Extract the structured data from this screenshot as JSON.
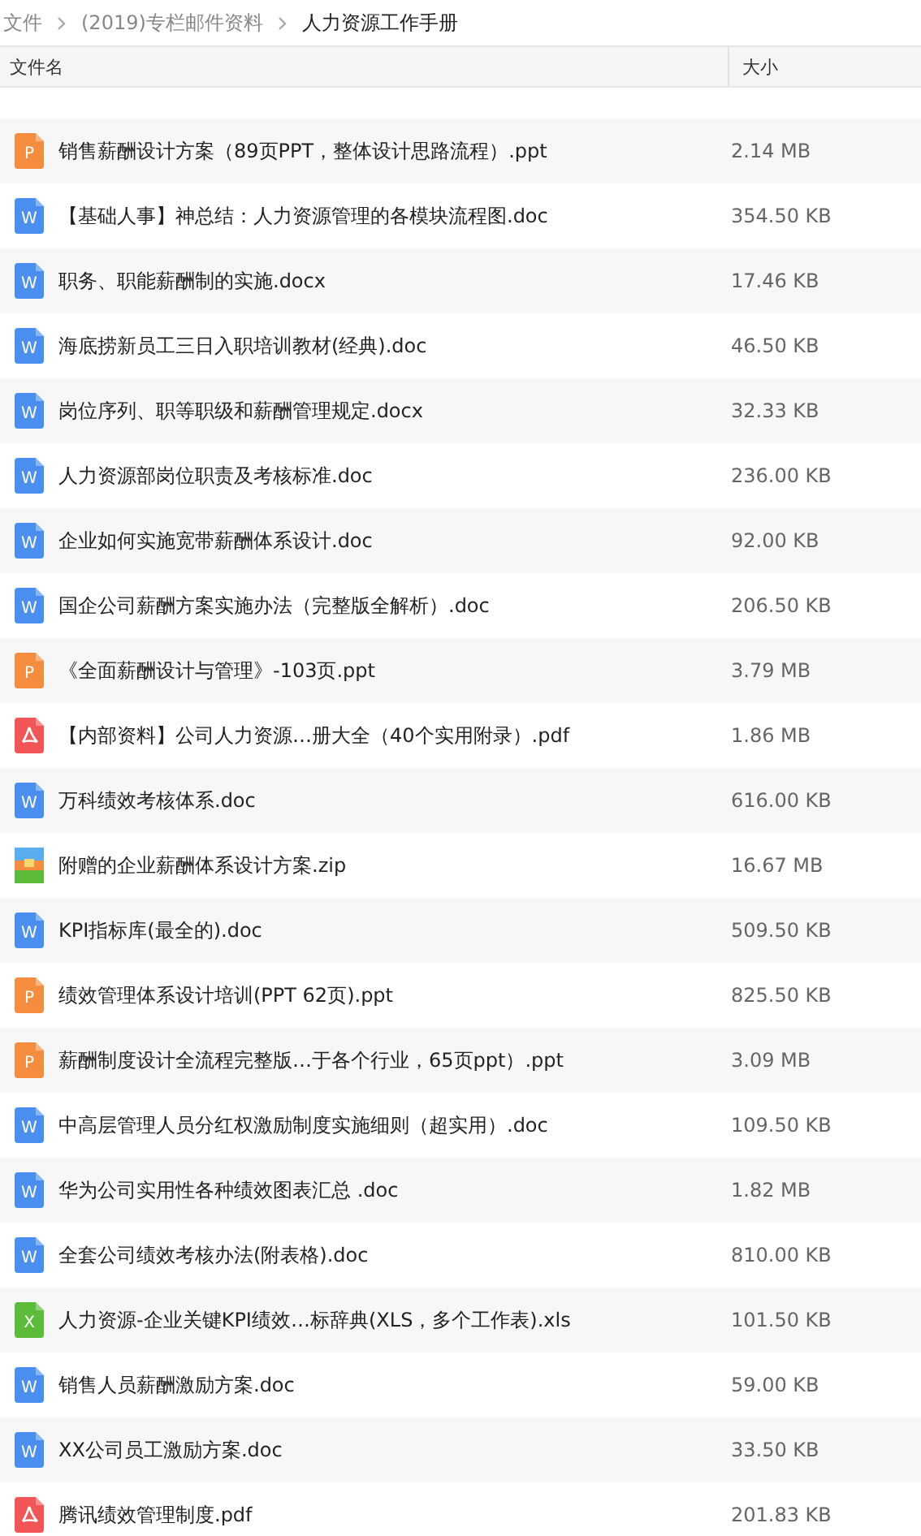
{
  "breadcrumb": [
    {
      "label": "文件",
      "current": false
    },
    {
      "label": "(2019)专栏邮件资料",
      "current": false
    },
    {
      "label": "人力资源工作手册",
      "current": true
    }
  ],
  "table": {
    "columns": [
      "文件名",
      "大小"
    ],
    "rows": [
      {
        "kind": "ppt",
        "icon_text": "P",
        "name": "销售薪酬设计方案（89页PPT，整体设计思路流程）.ppt",
        "size": "2.14 MB"
      },
      {
        "kind": "doc",
        "icon_text": "W",
        "name": "【基础人事】神总结：人力资源管理的各模块流程图.doc",
        "size": "354.50 KB"
      },
      {
        "kind": "doc",
        "icon_text": "W",
        "name": "职务、职能薪酬制的实施.docx",
        "size": "17.46 KB"
      },
      {
        "kind": "doc",
        "icon_text": "W",
        "name": "海底捞新员工三日入职培训教材(经典).doc",
        "size": "46.50 KB"
      },
      {
        "kind": "doc",
        "icon_text": "W",
        "name": "岗位序列、职等职级和薪酬管理规定.docx",
        "size": "32.33 KB"
      },
      {
        "kind": "doc",
        "icon_text": "W",
        "name": "人力资源部岗位职责及考核标准.doc",
        "size": "236.00 KB"
      },
      {
        "kind": "doc",
        "icon_text": "W",
        "name": "企业如何实施宽带薪酬体系设计.doc",
        "size": "92.00 KB"
      },
      {
        "kind": "doc",
        "icon_text": "W",
        "name": "国企公司薪酬方案实施办法（完整版全解析）.doc",
        "size": "206.50 KB"
      },
      {
        "kind": "ppt",
        "icon_text": "P",
        "name": "《全面薪酬设计与管理》-103页.ppt",
        "size": "3.79 MB"
      },
      {
        "kind": "pdf",
        "name": "【内部资料】公司人力资源…册大全（40个实用附录）.pdf",
        "size": "1.86 MB"
      },
      {
        "kind": "doc",
        "icon_text": "W",
        "name": "万科绩效考核体系.doc",
        "size": "616.00 KB"
      },
      {
        "kind": "zip",
        "name": "附赠的企业薪酬体系设计方案.zip",
        "size": "16.67 MB"
      },
      {
        "kind": "doc",
        "icon_text": "W",
        "name": "KPI指标库(最全的).doc",
        "size": "509.50 KB"
      },
      {
        "kind": "ppt",
        "icon_text": "P",
        "name": "绩效管理体系设计培训(PPT 62页).ppt",
        "size": "825.50 KB"
      },
      {
        "kind": "ppt",
        "icon_text": "P",
        "name": "薪酬制度设计全流程完整版…于各个行业，65页ppt）.ppt",
        "size": "3.09 MB"
      },
      {
        "kind": "doc",
        "icon_text": "W",
        "name": "中高层管理人员分红权激励制度实施细则（超实用）.doc",
        "size": "109.50 KB"
      },
      {
        "kind": "doc",
        "icon_text": "W",
        "name": "华为公司实用性各种绩效图表汇总 .doc",
        "size": "1.82 MB"
      },
      {
        "kind": "doc",
        "icon_text": "W",
        "name": "全套公司绩效考核办法(附表格).doc",
        "size": "810.00 KB"
      },
      {
        "kind": "xls",
        "icon_text": "X",
        "name": "人力资源-企业关键KPI绩效…标辞典(XLS，多个工作表).xls",
        "size": "101.50 KB"
      },
      {
        "kind": "doc",
        "icon_text": "W",
        "name": "销售人员薪酬激励方案.doc",
        "size": "59.00 KB"
      },
      {
        "kind": "doc",
        "icon_text": "W",
        "name": "XX公司员工激励方案.doc",
        "size": "33.50 KB"
      },
      {
        "kind": "pdf",
        "name": "腾讯绩效管理制度.pdf",
        "size": "201.83 KB"
      }
    ]
  }
}
